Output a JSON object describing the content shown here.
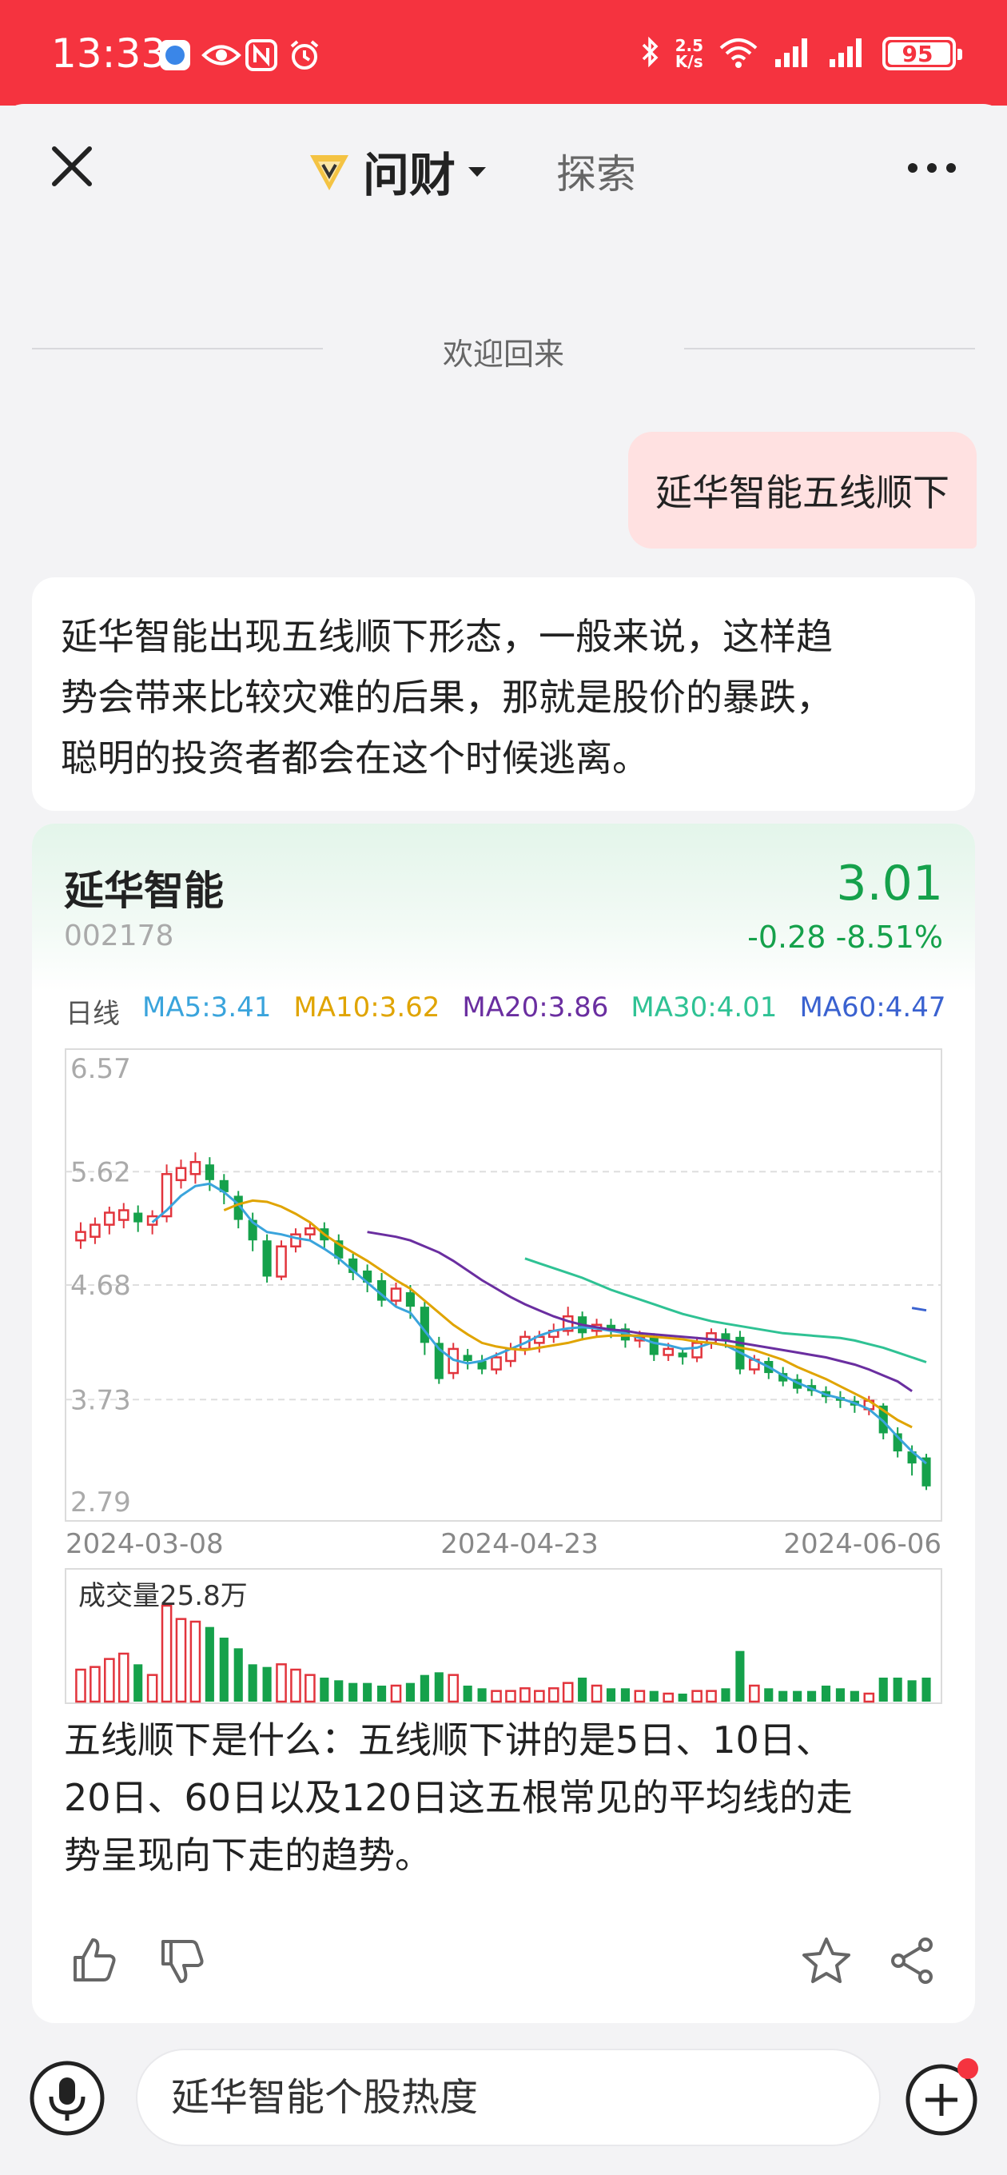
{
  "status_bar": {
    "time": "13:33",
    "net_speed_value": "2.5",
    "net_speed_unit": "K/s",
    "battery": "95"
  },
  "header": {
    "app_name": "问财",
    "explore_tab": "探索"
  },
  "divider_text": "欢迎回来",
  "user_message": "延华智能五线顺下",
  "ai_intro_lines": [
    "延华智能出现五线顺下形态，一般来说，这样趋",
    "势会带来比较灾难的后果，那就是股价的暴跌，",
    "聪明的投资者都会在这个时候逃离。"
  ],
  "stock": {
    "name": "延华智能",
    "code": "002178",
    "price": "3.01",
    "change": "-0.28",
    "change_pct": "-8.51%",
    "up_color": "#e2343c",
    "down_color": "#15a14b"
  },
  "ma_legend": {
    "period": "日线",
    "items": [
      {
        "label": "MA5:3.41",
        "color": "#3aa4dc"
      },
      {
        "label": "MA10:3.62",
        "color": "#e0a400"
      },
      {
        "label": "MA20:3.86",
        "color": "#6a2ea0"
      },
      {
        "label": "MA30:4.01",
        "color": "#2fc294"
      },
      {
        "label": "MA60:4.47",
        "color": "#3a62d0"
      }
    ]
  },
  "chart_data": {
    "type": "candlestick",
    "y_ticks": [
      "6.57",
      "5.62",
      "4.68",
      "3.73",
      "2.79"
    ],
    "ylim": [
      2.79,
      6.57
    ],
    "x_ticks": [
      "2024-03-08",
      "2024-04-23",
      "2024-06-06"
    ],
    "volume_label": "成交量25.8万",
    "candles": [
      {
        "o": 5.05,
        "c": 5.12,
        "h": 5.2,
        "l": 4.98,
        "v": 1.2
      },
      {
        "o": 5.08,
        "c": 5.18,
        "h": 5.24,
        "l": 5.02,
        "v": 1.3
      },
      {
        "o": 5.18,
        "c": 5.28,
        "h": 5.33,
        "l": 5.1,
        "v": 1.6
      },
      {
        "o": 5.22,
        "c": 5.3,
        "h": 5.36,
        "l": 5.15,
        "v": 1.8
      },
      {
        "o": 5.28,
        "c": 5.2,
        "h": 5.34,
        "l": 5.12,
        "v": 1.4
      },
      {
        "o": 5.18,
        "c": 5.25,
        "h": 5.3,
        "l": 5.1,
        "v": 1.0
      },
      {
        "o": 5.25,
        "c": 5.6,
        "h": 5.68,
        "l": 5.2,
        "v": 3.6
      },
      {
        "o": 5.55,
        "c": 5.65,
        "h": 5.72,
        "l": 5.48,
        "v": 3.1
      },
      {
        "o": 5.6,
        "c": 5.7,
        "h": 5.78,
        "l": 5.52,
        "v": 3.0
      },
      {
        "o": 5.68,
        "c": 5.55,
        "h": 5.74,
        "l": 5.46,
        "v": 2.8
      },
      {
        "o": 5.55,
        "c": 5.45,
        "h": 5.6,
        "l": 5.35,
        "v": 2.4
      },
      {
        "o": 5.42,
        "c": 5.22,
        "h": 5.46,
        "l": 5.15,
        "v": 2.0
      },
      {
        "o": 5.22,
        "c": 5.05,
        "h": 5.28,
        "l": 4.96,
        "v": 1.4
      },
      {
        "o": 5.05,
        "c": 4.75,
        "h": 5.1,
        "l": 4.7,
        "v": 1.3
      },
      {
        "o": 4.75,
        "c": 5.0,
        "h": 5.05,
        "l": 4.72,
        "v": 1.4
      },
      {
        "o": 5.0,
        "c": 5.1,
        "h": 5.15,
        "l": 4.95,
        "v": 1.2
      },
      {
        "o": 5.1,
        "c": 5.15,
        "h": 5.2,
        "l": 5.05,
        "v": 1.0
      },
      {
        "o": 5.15,
        "c": 5.05,
        "h": 5.2,
        "l": 4.98,
        "v": 0.9
      },
      {
        "o": 5.05,
        "c": 4.9,
        "h": 5.1,
        "l": 4.85,
        "v": 0.8
      },
      {
        "o": 4.9,
        "c": 4.78,
        "h": 4.94,
        "l": 4.72,
        "v": 0.7
      },
      {
        "o": 4.8,
        "c": 4.7,
        "h": 4.85,
        "l": 4.62,
        "v": 0.7
      },
      {
        "o": 4.72,
        "c": 4.55,
        "h": 4.78,
        "l": 4.5,
        "v": 0.6
      },
      {
        "o": 4.55,
        "c": 4.65,
        "h": 4.7,
        "l": 4.5,
        "v": 0.6
      },
      {
        "o": 4.62,
        "c": 4.5,
        "h": 4.68,
        "l": 4.4,
        "v": 0.7
      },
      {
        "o": 4.5,
        "c": 4.2,
        "h": 4.54,
        "l": 4.1,
        "v": 1.0
      },
      {
        "o": 4.2,
        "c": 3.9,
        "h": 4.25,
        "l": 3.86,
        "v": 1.1
      },
      {
        "o": 3.95,
        "c": 4.15,
        "h": 4.2,
        "l": 3.9,
        "v": 1.0
      },
      {
        "o": 4.1,
        "c": 4.05,
        "h": 4.15,
        "l": 3.98,
        "v": 0.6
      },
      {
        "o": 4.05,
        "c": 3.98,
        "h": 4.1,
        "l": 3.94,
        "v": 0.5
      },
      {
        "o": 3.98,
        "c": 4.08,
        "h": 4.12,
        "l": 3.94,
        "v": 0.4
      },
      {
        "o": 4.05,
        "c": 4.15,
        "h": 4.2,
        "l": 4.0,
        "v": 0.4
      },
      {
        "o": 4.15,
        "c": 4.25,
        "h": 4.3,
        "l": 4.1,
        "v": 0.5
      },
      {
        "o": 4.2,
        "c": 4.25,
        "h": 4.3,
        "l": 4.12,
        "v": 0.4
      },
      {
        "o": 4.25,
        "c": 4.3,
        "h": 4.36,
        "l": 4.2,
        "v": 0.5
      },
      {
        "o": 4.3,
        "c": 4.42,
        "h": 4.5,
        "l": 4.26,
        "v": 0.7
      },
      {
        "o": 4.42,
        "c": 4.28,
        "h": 4.46,
        "l": 4.22,
        "v": 0.9
      },
      {
        "o": 4.3,
        "c": 4.35,
        "h": 4.4,
        "l": 4.25,
        "v": 0.6
      },
      {
        "o": 4.35,
        "c": 4.3,
        "h": 4.4,
        "l": 4.24,
        "v": 0.5
      },
      {
        "o": 4.32,
        "c": 4.22,
        "h": 4.36,
        "l": 4.16,
        "v": 0.5
      },
      {
        "o": 4.22,
        "c": 4.25,
        "h": 4.3,
        "l": 4.16,
        "v": 0.4
      },
      {
        "o": 4.25,
        "c": 4.1,
        "h": 4.28,
        "l": 4.05,
        "v": 0.4
      },
      {
        "o": 4.1,
        "c": 4.15,
        "h": 4.2,
        "l": 4.05,
        "v": 0.3
      },
      {
        "o": 4.12,
        "c": 4.08,
        "h": 4.16,
        "l": 4.02,
        "v": 0.3
      },
      {
        "o": 4.08,
        "c": 4.2,
        "h": 4.25,
        "l": 4.04,
        "v": 0.4
      },
      {
        "o": 4.2,
        "c": 4.28,
        "h": 4.32,
        "l": 4.15,
        "v": 0.4
      },
      {
        "o": 4.28,
        "c": 4.22,
        "h": 4.32,
        "l": 4.16,
        "v": 0.5
      },
      {
        "o": 4.25,
        "c": 3.98,
        "h": 4.3,
        "l": 3.94,
        "v": 1.9
      },
      {
        "o": 3.98,
        "c": 4.06,
        "h": 4.1,
        "l": 3.94,
        "v": 0.6
      },
      {
        "o": 4.05,
        "c": 3.95,
        "h": 4.08,
        "l": 3.9,
        "v": 0.5
      },
      {
        "o": 3.95,
        "c": 3.88,
        "h": 4.0,
        "l": 3.84,
        "v": 0.4
      },
      {
        "o": 3.9,
        "c": 3.82,
        "h": 3.94,
        "l": 3.78,
        "v": 0.4
      },
      {
        "o": 3.85,
        "c": 3.8,
        "h": 3.9,
        "l": 3.76,
        "v": 0.4
      },
      {
        "o": 3.8,
        "c": 3.75,
        "h": 3.84,
        "l": 3.7,
        "v": 0.6
      },
      {
        "o": 3.75,
        "c": 3.72,
        "h": 3.8,
        "l": 3.66,
        "v": 0.5
      },
      {
        "o": 3.72,
        "c": 3.68,
        "h": 3.76,
        "l": 3.62,
        "v": 0.4
      },
      {
        "o": 3.65,
        "c": 3.72,
        "h": 3.76,
        "l": 3.6,
        "v": 0.3
      },
      {
        "o": 3.68,
        "c": 3.45,
        "h": 3.7,
        "l": 3.4,
        "v": 0.9
      },
      {
        "o": 3.45,
        "c": 3.3,
        "h": 3.5,
        "l": 3.25,
        "v": 0.9
      },
      {
        "o": 3.3,
        "c": 3.2,
        "h": 3.35,
        "l": 3.1,
        "v": 0.8
      },
      {
        "o": 3.25,
        "c": 3.01,
        "h": 3.28,
        "l": 2.98,
        "v": 0.9
      }
    ],
    "ma_series": [
      {
        "name": "MA5",
        "color": "#3aa4dc",
        "start": 5,
        "values": [
          5.2,
          5.3,
          5.42,
          5.5,
          5.52,
          5.45,
          5.35,
          5.2,
          5.12,
          5.1,
          5.07,
          5.05,
          4.98,
          4.9,
          4.8,
          4.7,
          4.6,
          4.5,
          4.45,
          4.3,
          4.15,
          4.06,
          4.03,
          4.05,
          4.1,
          4.15,
          4.2,
          4.26,
          4.3,
          4.32,
          4.33,
          4.32,
          4.3,
          4.28,
          4.24,
          4.2,
          4.18,
          4.15,
          4.16,
          4.2,
          4.18,
          4.12,
          4.06,
          4.0,
          3.93,
          3.87,
          3.82,
          3.77,
          3.74,
          3.7,
          3.65,
          3.55,
          3.42,
          3.3,
          3.2
        ]
      },
      {
        "name": "MA10",
        "color": "#e0a400",
        "start": 10,
        "values": [
          5.3,
          5.35,
          5.38,
          5.37,
          5.33,
          5.27,
          5.2,
          5.1,
          5.02,
          4.95,
          4.88,
          4.8,
          4.72,
          4.65,
          4.55,
          4.45,
          4.35,
          4.27,
          4.2,
          4.17,
          4.15,
          4.14,
          4.16,
          4.18,
          4.2,
          4.23,
          4.25,
          4.26,
          4.26,
          4.26,
          4.25,
          4.24,
          4.23,
          4.21,
          4.2,
          4.18,
          4.16,
          4.14,
          4.1,
          4.06,
          4.0,
          3.95,
          3.9,
          3.84,
          3.78,
          3.72,
          3.64,
          3.56,
          3.5
        ]
      },
      {
        "name": "MA20",
        "color": "#6a2ea0",
        "start": 20,
        "values": [
          5.12,
          5.1,
          5.08,
          5.05,
          5.0,
          4.95,
          4.88,
          4.8,
          4.72,
          4.65,
          4.58,
          4.52,
          4.47,
          4.42,
          4.38,
          4.35,
          4.33,
          4.31,
          4.3,
          4.28,
          4.27,
          4.26,
          4.25,
          4.24,
          4.23,
          4.22,
          4.2,
          4.18,
          4.16,
          4.14,
          4.12,
          4.1,
          4.08,
          4.05,
          4.02,
          3.98,
          3.93,
          3.88,
          3.8
        ]
      },
      {
        "name": "MA30",
        "color": "#2fc294",
        "start": 31,
        "values": [
          4.9,
          4.86,
          4.82,
          4.78,
          4.74,
          4.69,
          4.64,
          4.6,
          4.56,
          4.52,
          4.48,
          4.44,
          4.41,
          4.38,
          4.36,
          4.34,
          4.32,
          4.3,
          4.28,
          4.27,
          4.26,
          4.25,
          4.24,
          4.22,
          4.19,
          4.16,
          4.12,
          4.08,
          4.04
        ]
      },
      {
        "name": "MA60",
        "color": "#3a62d0",
        "start": 58,
        "values": [
          4.49,
          4.47
        ]
      }
    ]
  },
  "explain_lines": [
    "五线顺下是什么：五线顺下讲的是5日、10日、",
    "20日、60日以及120日这五根常见的平均线的走",
    "势呈现向下走的趋势。"
  ],
  "input": {
    "placeholder": "延华智能个股热度"
  }
}
